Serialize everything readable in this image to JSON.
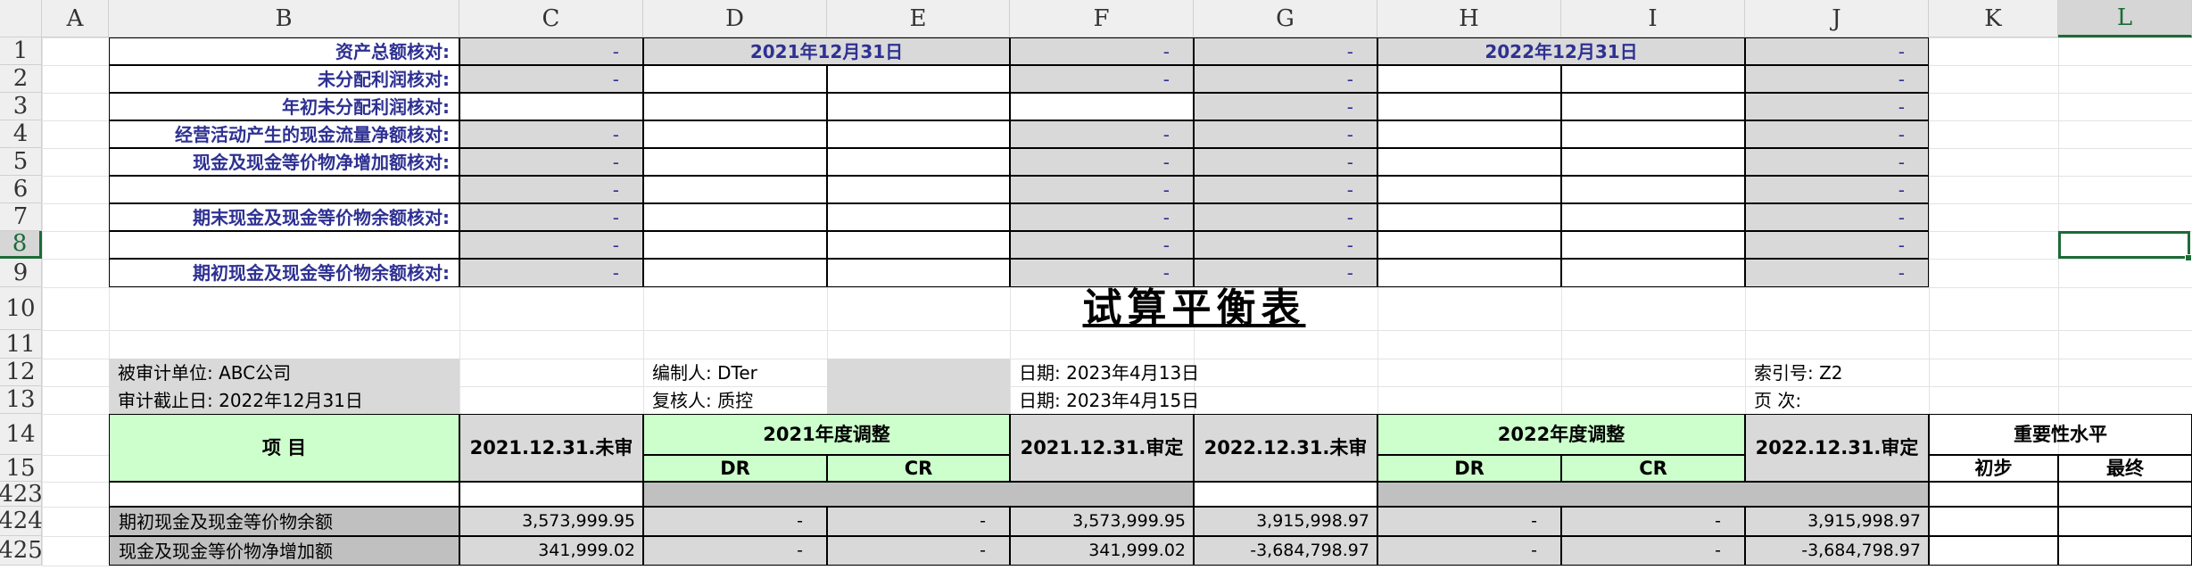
{
  "column_headers": [
    "A",
    "B",
    "C",
    "D",
    "E",
    "F",
    "G",
    "H",
    "I",
    "J",
    "K",
    "L"
  ],
  "row_headers": [
    "1",
    "2",
    "3",
    "4",
    "5",
    "6",
    "7",
    "8",
    "9",
    "10",
    "11",
    "12",
    "13",
    "14",
    "15",
    "423",
    "424",
    "425"
  ],
  "checks": {
    "labels": [
      "资产总额核对:",
      "未分配利润核对:",
      "年初未分配利润核对:",
      "经营活动产生的现金流量净额核对:",
      "现金及现金等价物净增加额核对:",
      "",
      "期末现金及现金等价物余额核对:",
      "",
      "期初现金及现金等价物余额核对:"
    ],
    "dash": "-",
    "date_2021": "2021年12月31日",
    "date_2022": "2022年12月31日"
  },
  "title": "试算平衡表",
  "info": {
    "unit": "被审计单位: ABC公司",
    "cutoff": "审计截止日: 2022年12月31日",
    "preparer": "编制人: DTer",
    "reviewer": "复核人: 质控",
    "date1": "日期: 2023年4月13日",
    "date2": "日期: 2023年4月15日",
    "index": "索引号: Z2",
    "page": "页    次:"
  },
  "table_header": {
    "item": "项    目",
    "c2021_unaudited": "2021.12.31.未审",
    "adj2021": "2021年度调整",
    "dr": "DR",
    "cr": "CR",
    "c2021_audited": "2021.12.31.审定",
    "c2022_unaudited": "2022.12.31.未审",
    "adj2022": "2022年度调整",
    "c2022_audited": "2022.12.31.审定",
    "materiality": "重要性水平",
    "initial": "初步",
    "final": "最终"
  },
  "rows": [
    {
      "label": "期初现金及现金等价物余额",
      "v2021u": "3,573,999.95",
      "dr21": "-",
      "cr21": "-",
      "v2021a": "3,573,999.95",
      "v2022u": "3,915,998.97",
      "dr22": "-",
      "cr22": "-",
      "v2022a": "3,915,998.97"
    },
    {
      "label": "现金及现金等价物净增加额",
      "v2021u": "341,999.02",
      "dr21": "-",
      "cr21": "-",
      "v2021a": "341,999.02",
      "v2022u": "-3,684,798.97",
      "dr22": "-",
      "cr22": "-",
      "v2022a": "-3,684,798.97"
    }
  ],
  "colors": {
    "gray": "#d9d9d9",
    "green": "#ccffcc",
    "label_blue": "#2e3192",
    "selection": "#1c6b37"
  }
}
